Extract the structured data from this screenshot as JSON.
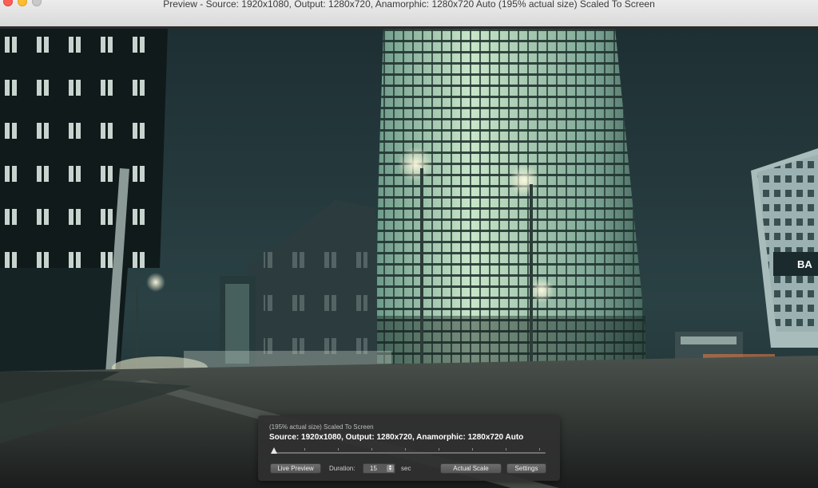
{
  "window": {
    "title": "Preview - Source: 1920x1080, Output: 1280x720, Anamorphic: 1280x720 Auto (195% actual size) Scaled To Screen"
  },
  "preview": {
    "sign_text": "BA"
  },
  "hud": {
    "scale_text": "(195% actual size) Scaled To Screen",
    "info_text": "Source: 1920x1080, Output: 1280x720, Anamorphic: 1280x720 Auto",
    "live_preview_label": "Live Preview",
    "duration_label": "Duration:",
    "duration_value": "15",
    "duration_unit": "sec",
    "actual_scale_label": "Actual Scale",
    "settings_label": "Settings",
    "scrubber_position": 0
  },
  "colors": {
    "sky": "#1d3134",
    "glow": "#e9ffe6",
    "hud_bg": "#303030"
  }
}
